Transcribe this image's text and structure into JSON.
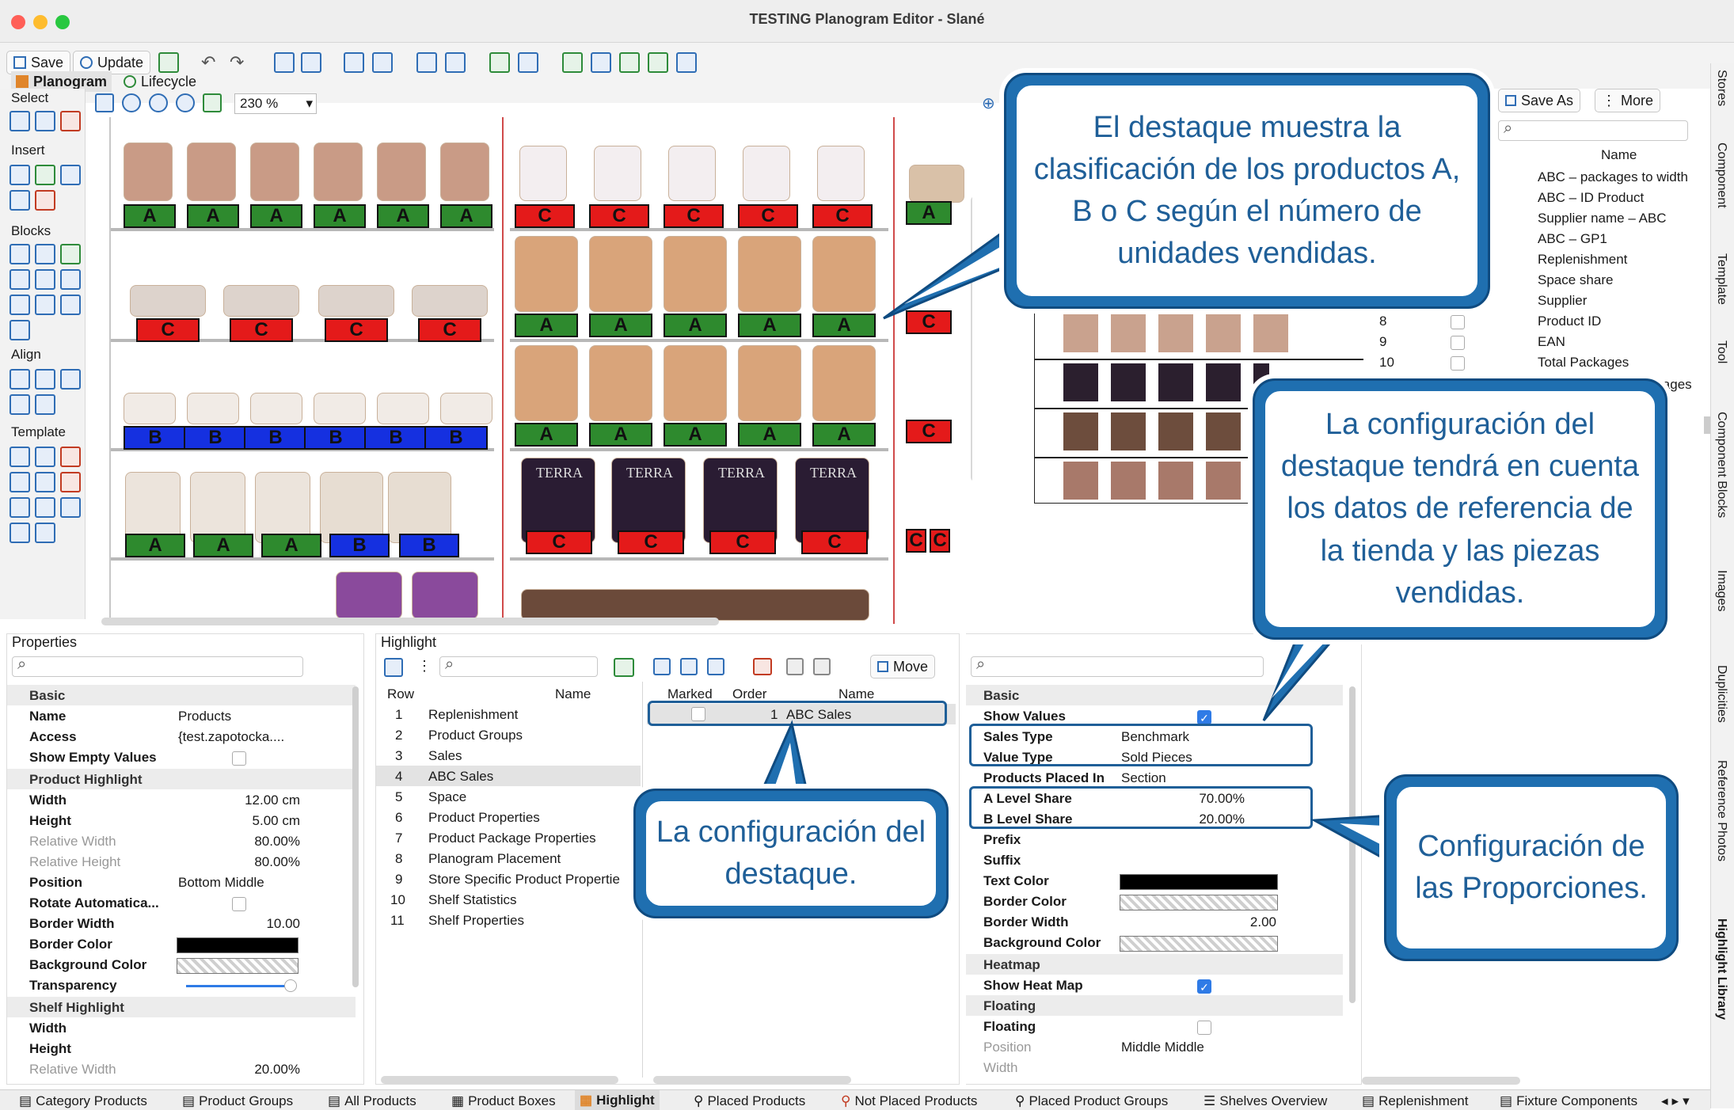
{
  "window": {
    "title": "TESTING Planogram Editor - Slané"
  },
  "toolbar": {
    "save": "Save",
    "update": "Update",
    "zoom": "230 %"
  },
  "tabs": [
    {
      "label": "Planogram"
    },
    {
      "label": "Lifecycle"
    }
  ],
  "palette": {
    "select": "Select",
    "insert": "Insert",
    "blocks": "Blocks",
    "align": "Align",
    "template": "Template"
  },
  "planogram": {
    "shelf1": [
      "A",
      "A",
      "A",
      "A",
      "A",
      "A"
    ],
    "shelf2": [
      "C",
      "C",
      "C",
      "C"
    ],
    "shelf3": [
      "B",
      "B",
      "B",
      "B",
      "B",
      "B"
    ],
    "shelf4": [
      "A",
      "A",
      "A",
      "B",
      "B"
    ],
    "bay2_row1": [
      "C",
      "C",
      "C",
      "C",
      "C"
    ],
    "bay2_row2": [
      "A",
      "A",
      "A",
      "A",
      "A"
    ],
    "bay2_row3": [
      "A",
      "A",
      "A",
      "A",
      "A"
    ],
    "bay2_row4": [
      "C",
      "C",
      "C",
      "C"
    ],
    "bay3": [
      "A",
      "C",
      "C",
      "C",
      "C"
    ],
    "brand": "TERRA"
  },
  "stores_panel": {
    "save_as": "Save As",
    "more": "More",
    "name_header": "Name",
    "items": [
      {
        "num": "",
        "name": "ABC – packages to width"
      },
      {
        "num": "",
        "name": "ABC – ID Product"
      },
      {
        "num": "",
        "name": "Supplier name – ABC"
      },
      {
        "num": "",
        "name": "ABC – GP1"
      },
      {
        "num": "",
        "name": "Replenishment"
      },
      {
        "num": "",
        "name": "Space share"
      },
      {
        "num": "",
        "name": "Supplier"
      },
      {
        "num": "8",
        "name": "Product ID"
      },
      {
        "num": "9",
        "name": "EAN"
      },
      {
        "num": "10",
        "name": "Total Packages"
      }
    ],
    "partial": "Packages"
  },
  "right_tabs": [
    "Stores",
    "Component",
    "Template",
    "Tool",
    "Component Blocks",
    "Images",
    "Duplicities",
    "Reference Photos",
    "Highlight Library"
  ],
  "properties": {
    "title": "Properties",
    "sections": {
      "basic": "Basic",
      "product_highlight": "Product Highlight",
      "shelf_highlight": "Shelf Highlight"
    },
    "rows": [
      {
        "key": "Name",
        "value": "Products"
      },
      {
        "key": "Access",
        "value": "{test.zapotocka...."
      },
      {
        "key": "Show Empty Values",
        "value": ""
      },
      {
        "key": "Width",
        "value": "12.00 cm"
      },
      {
        "key": "Height",
        "value": "5.00 cm"
      },
      {
        "key": "Relative Width",
        "value": "80.00%"
      },
      {
        "key": "Relative Height",
        "value": "80.00%"
      },
      {
        "key": "Position",
        "value": "Bottom Middle"
      },
      {
        "key": "Rotate Automatica...",
        "value": ""
      },
      {
        "key": "Border Width",
        "value": "10.00"
      },
      {
        "key": "Border Color",
        "value": ""
      },
      {
        "key": "Background Color",
        "value": ""
      },
      {
        "key": "Transparency",
        "value": ""
      }
    ],
    "shelf_rows": [
      {
        "key": "Width",
        "value": ""
      },
      {
        "key": "Height",
        "value": ""
      },
      {
        "key": "Relative Width",
        "value": "20.00%"
      }
    ]
  },
  "highlight": {
    "title": "Highlight",
    "move": "Move",
    "headers": {
      "row": "Row",
      "name": "Name",
      "marked": "Marked",
      "order": "Order",
      "name2": "Name"
    },
    "items": [
      {
        "row": "1",
        "name": "Replenishment"
      },
      {
        "row": "2",
        "name": "Product Groups"
      },
      {
        "row": "3",
        "name": "Sales"
      },
      {
        "row": "4",
        "name": "ABC Sales"
      },
      {
        "row": "5",
        "name": "Space"
      },
      {
        "row": "6",
        "name": "Product Properties"
      },
      {
        "row": "7",
        "name": "Product Package Properties"
      },
      {
        "row": "8",
        "name": "Planogram Placement"
      },
      {
        "row": "9",
        "name": "Store Specific Product Propertie"
      },
      {
        "row": "10",
        "name": "Shelf Statistics"
      },
      {
        "row": "11",
        "name": "Shelf Properties"
      }
    ],
    "selected": {
      "order": "1",
      "name": "ABC Sales"
    }
  },
  "config": {
    "sections": {
      "basic": "Basic",
      "heatmap": "Heatmap",
      "floating": "Floating"
    },
    "rows": [
      {
        "key": "Show Values",
        "value": ""
      },
      {
        "key": "Sales Type",
        "value": "Benchmark"
      },
      {
        "key": "Value Type",
        "value": "Sold Pieces"
      },
      {
        "key": "Products Placed In",
        "value": "Section"
      },
      {
        "key": "A Level Share",
        "value": "70.00%"
      },
      {
        "key": "B Level Share",
        "value": "20.00%"
      },
      {
        "key": "Prefix",
        "value": ""
      },
      {
        "key": "Suffix",
        "value": ""
      },
      {
        "key": "Text Color",
        "value": ""
      },
      {
        "key": "Border Color",
        "value": ""
      },
      {
        "key": "Border Width",
        "value": "2.00"
      },
      {
        "key": "Background Color",
        "value": ""
      }
    ],
    "heatmap_rows": [
      {
        "key": "Show Heat Map",
        "value": ""
      }
    ],
    "floating_rows": [
      {
        "key": "Floating",
        "value": ""
      },
      {
        "key": "Position",
        "value": "Middle Middle"
      },
      {
        "key": "Width",
        "value": ""
      }
    ]
  },
  "bottom_tabs": [
    "Category Products",
    "Product Groups",
    "All Products",
    "Product Boxes",
    "Highlight",
    "Placed Products",
    "Not Placed Products",
    "Placed Product Groups",
    "Shelves Overview",
    "Replenishment",
    "Fixture Components"
  ],
  "callouts": {
    "c1": "El destaque muestra la clasificación de los productos A, B o C según el número de unidades vendidas.",
    "c2": "La configuración del destaque tendrá en cuenta los datos de referencia de la tienda y las piezas vendidas.",
    "c3": "La configuración del destaque.",
    "c4": "Configuración de las Proporciones."
  },
  "colors": {
    "A": "#2e8a2e",
    "B": "#1530e0",
    "C": "#e41a1a",
    "callout": "#1f6fb0"
  }
}
